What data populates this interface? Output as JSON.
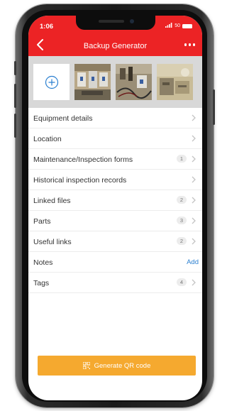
{
  "status": {
    "time": "1:06",
    "carrier": "50"
  },
  "header": {
    "title": "Backup Generator",
    "back_icon": "chevron-left-icon",
    "more_icon": "more-icon"
  },
  "photos": {
    "add_icon": "plus-circle-icon",
    "count": 3
  },
  "list": {
    "items": [
      {
        "label": "Equipment details",
        "count": null,
        "action": null
      },
      {
        "label": "Location",
        "count": null,
        "action": null
      },
      {
        "label": "Maintenance/Inspection forms",
        "count": "1",
        "action": null
      },
      {
        "label": "Historical inspection records",
        "count": null,
        "action": null
      },
      {
        "label": "Linked files",
        "count": "2",
        "action": null
      },
      {
        "label": "Parts",
        "count": "3",
        "action": null
      },
      {
        "label": "Useful links",
        "count": "2",
        "action": null
      },
      {
        "label": "Notes",
        "count": null,
        "action": "Add"
      },
      {
        "label": "Tags",
        "count": "4",
        "action": null
      }
    ]
  },
  "footer": {
    "button_label": "Generate QR code",
    "button_icon": "qr-code-icon"
  },
  "colors": {
    "header": "#ec2325",
    "button": "#f5a92f",
    "link": "#2a7fd0"
  }
}
